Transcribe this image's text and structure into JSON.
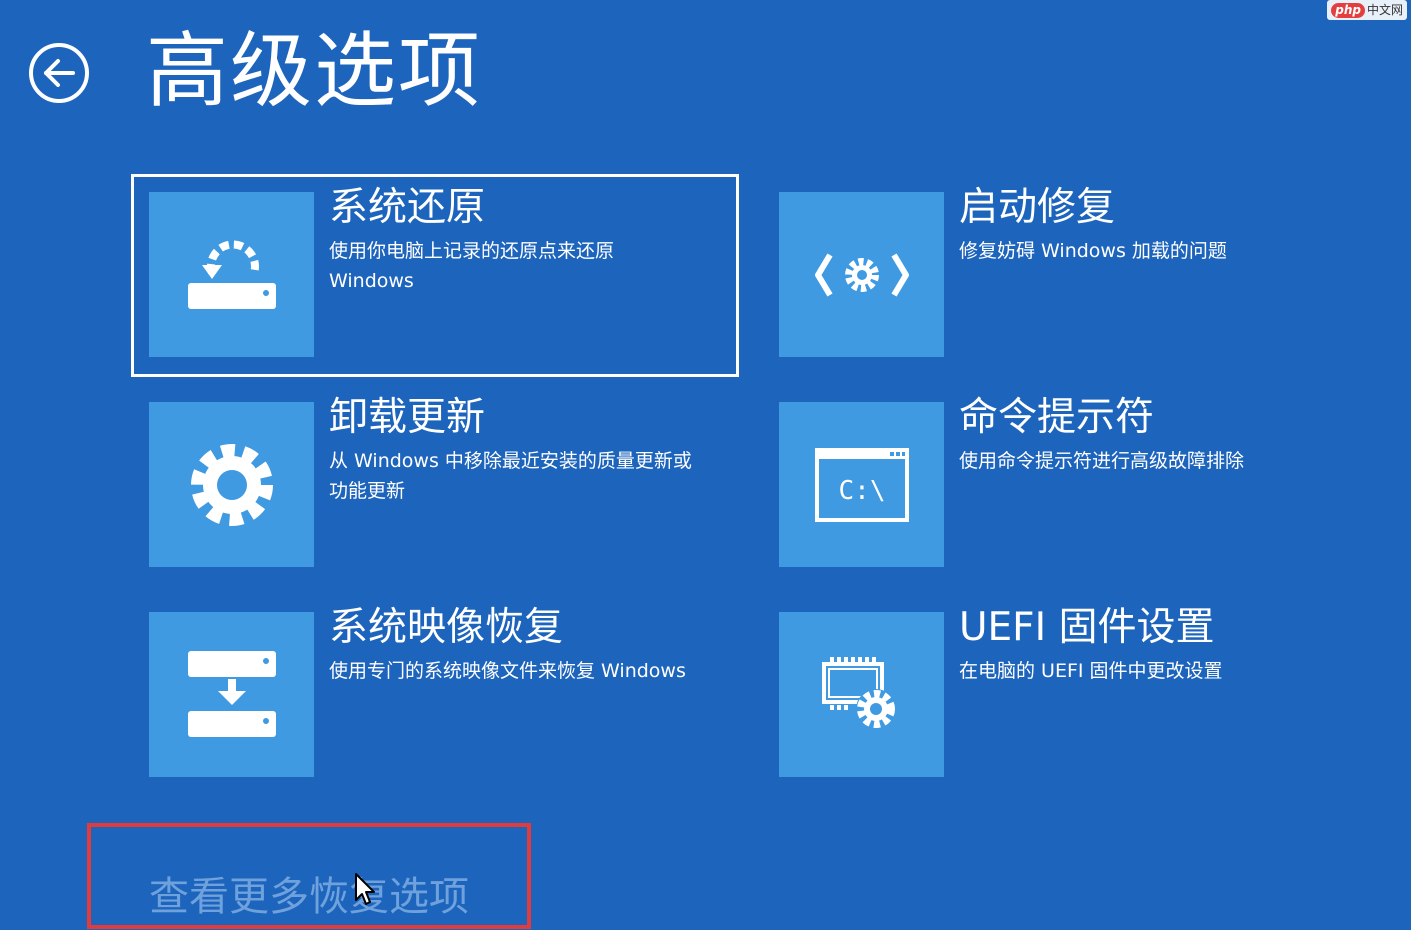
{
  "page": {
    "title": "高级选项",
    "back_icon": "back-arrow-icon"
  },
  "options": [
    {
      "name": "系统还原",
      "description": "使用你电脑上记录的还原点来还原 Windows",
      "icon": "system-restore-icon",
      "selected": true
    },
    {
      "name": "启动修复",
      "description": "修复妨碍 Windows 加载的问题",
      "icon": "startup-repair-icon",
      "selected": false
    },
    {
      "name": "卸载更新",
      "description": "从 Windows 中移除最近安装的质量更新或功能更新",
      "icon": "gear-icon",
      "selected": false
    },
    {
      "name": "命令提示符",
      "description": "使用命令提示符进行高级故障排除",
      "icon": "command-prompt-icon",
      "selected": false
    },
    {
      "name": "系统映像恢复",
      "description": "使用专门的系统映像文件来恢复 Windows",
      "icon": "system-image-recovery-icon",
      "selected": false
    },
    {
      "name": "UEFI 固件设置",
      "description": "在电脑的 UEFI 固件中更改设置",
      "icon": "uefi-firmware-icon",
      "selected": false
    }
  ],
  "cmd_icon_text": "C:\\",
  "more_options": {
    "label": "查看更多恢复选项"
  },
  "watermark": {
    "logo": "php",
    "text": "中文网"
  },
  "colors": {
    "background": "#1d64bd",
    "tile": "#3f9ae2",
    "highlight": "#e23b3b",
    "link": "#6fa2dc"
  }
}
